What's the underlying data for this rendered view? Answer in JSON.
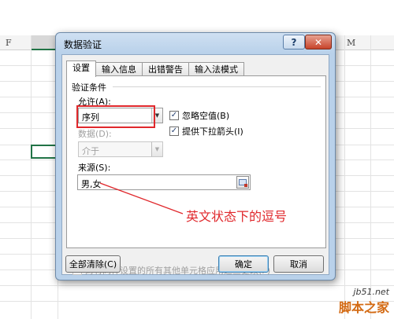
{
  "sheet": {
    "columns": [
      "F",
      "M"
    ]
  },
  "dialog": {
    "title": "数据验证",
    "help_label": "?",
    "close_label": "✕",
    "tabs": [
      "设置",
      "输入信息",
      "出错警告",
      "输入法模式"
    ],
    "section_title": "验证条件",
    "allow_label": "允许(A):",
    "allow_value": "序列",
    "data_label": "数据(D):",
    "data_value": "介于",
    "ignore_blank_label": "忽略空值(B)",
    "dropdown_arrow_label": "提供下拉箭头(I)",
    "source_label": "来源(S):",
    "source_value": "男,女",
    "apply_all_label": "对有同样设置的所有其他单元格应用这些更改(P)",
    "clear_all_label": "全部清除(C)",
    "ok_label": "确定",
    "cancel_label": "取消",
    "check_mark": "✓",
    "ignore_blank_checked": true,
    "dropdown_arrow_checked": true,
    "apply_all_checked": false
  },
  "annotation": "英文状态下的逗号",
  "watermark": {
    "site": "jb51.net",
    "name": "脚本之家"
  },
  "colors": {
    "annotation_red": "#e0282c",
    "selection_green": "#217346"
  }
}
